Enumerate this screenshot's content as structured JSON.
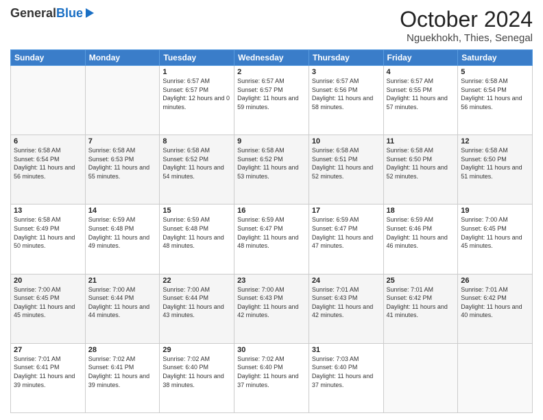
{
  "header": {
    "logo_line1": "General",
    "logo_line2": "Blue",
    "title": "October 2024",
    "subtitle": "Nguekhokh, Thies, Senegal"
  },
  "days_of_week": [
    "Sunday",
    "Monday",
    "Tuesday",
    "Wednesday",
    "Thursday",
    "Friday",
    "Saturday"
  ],
  "weeks": [
    [
      {
        "day": "",
        "sunrise": "",
        "sunset": "",
        "daylight": ""
      },
      {
        "day": "",
        "sunrise": "",
        "sunset": "",
        "daylight": ""
      },
      {
        "day": "1",
        "sunrise": "Sunrise: 6:57 AM",
        "sunset": "Sunset: 6:57 PM",
        "daylight": "Daylight: 12 hours and 0 minutes."
      },
      {
        "day": "2",
        "sunrise": "Sunrise: 6:57 AM",
        "sunset": "Sunset: 6:57 PM",
        "daylight": "Daylight: 11 hours and 59 minutes."
      },
      {
        "day": "3",
        "sunrise": "Sunrise: 6:57 AM",
        "sunset": "Sunset: 6:56 PM",
        "daylight": "Daylight: 11 hours and 58 minutes."
      },
      {
        "day": "4",
        "sunrise": "Sunrise: 6:57 AM",
        "sunset": "Sunset: 6:55 PM",
        "daylight": "Daylight: 11 hours and 57 minutes."
      },
      {
        "day": "5",
        "sunrise": "Sunrise: 6:58 AM",
        "sunset": "Sunset: 6:54 PM",
        "daylight": "Daylight: 11 hours and 56 minutes."
      }
    ],
    [
      {
        "day": "6",
        "sunrise": "Sunrise: 6:58 AM",
        "sunset": "Sunset: 6:54 PM",
        "daylight": "Daylight: 11 hours and 56 minutes."
      },
      {
        "day": "7",
        "sunrise": "Sunrise: 6:58 AM",
        "sunset": "Sunset: 6:53 PM",
        "daylight": "Daylight: 11 hours and 55 minutes."
      },
      {
        "day": "8",
        "sunrise": "Sunrise: 6:58 AM",
        "sunset": "Sunset: 6:52 PM",
        "daylight": "Daylight: 11 hours and 54 minutes."
      },
      {
        "day": "9",
        "sunrise": "Sunrise: 6:58 AM",
        "sunset": "Sunset: 6:52 PM",
        "daylight": "Daylight: 11 hours and 53 minutes."
      },
      {
        "day": "10",
        "sunrise": "Sunrise: 6:58 AM",
        "sunset": "Sunset: 6:51 PM",
        "daylight": "Daylight: 11 hours and 52 minutes."
      },
      {
        "day": "11",
        "sunrise": "Sunrise: 6:58 AM",
        "sunset": "Sunset: 6:50 PM",
        "daylight": "Daylight: 11 hours and 52 minutes."
      },
      {
        "day": "12",
        "sunrise": "Sunrise: 6:58 AM",
        "sunset": "Sunset: 6:50 PM",
        "daylight": "Daylight: 11 hours and 51 minutes."
      }
    ],
    [
      {
        "day": "13",
        "sunrise": "Sunrise: 6:58 AM",
        "sunset": "Sunset: 6:49 PM",
        "daylight": "Daylight: 11 hours and 50 minutes."
      },
      {
        "day": "14",
        "sunrise": "Sunrise: 6:59 AM",
        "sunset": "Sunset: 6:48 PM",
        "daylight": "Daylight: 11 hours and 49 minutes."
      },
      {
        "day": "15",
        "sunrise": "Sunrise: 6:59 AM",
        "sunset": "Sunset: 6:48 PM",
        "daylight": "Daylight: 11 hours and 48 minutes."
      },
      {
        "day": "16",
        "sunrise": "Sunrise: 6:59 AM",
        "sunset": "Sunset: 6:47 PM",
        "daylight": "Daylight: 11 hours and 48 minutes."
      },
      {
        "day": "17",
        "sunrise": "Sunrise: 6:59 AM",
        "sunset": "Sunset: 6:47 PM",
        "daylight": "Daylight: 11 hours and 47 minutes."
      },
      {
        "day": "18",
        "sunrise": "Sunrise: 6:59 AM",
        "sunset": "Sunset: 6:46 PM",
        "daylight": "Daylight: 11 hours and 46 minutes."
      },
      {
        "day": "19",
        "sunrise": "Sunrise: 7:00 AM",
        "sunset": "Sunset: 6:45 PM",
        "daylight": "Daylight: 11 hours and 45 minutes."
      }
    ],
    [
      {
        "day": "20",
        "sunrise": "Sunrise: 7:00 AM",
        "sunset": "Sunset: 6:45 PM",
        "daylight": "Daylight: 11 hours and 45 minutes."
      },
      {
        "day": "21",
        "sunrise": "Sunrise: 7:00 AM",
        "sunset": "Sunset: 6:44 PM",
        "daylight": "Daylight: 11 hours and 44 minutes."
      },
      {
        "day": "22",
        "sunrise": "Sunrise: 7:00 AM",
        "sunset": "Sunset: 6:44 PM",
        "daylight": "Daylight: 11 hours and 43 minutes."
      },
      {
        "day": "23",
        "sunrise": "Sunrise: 7:00 AM",
        "sunset": "Sunset: 6:43 PM",
        "daylight": "Daylight: 11 hours and 42 minutes."
      },
      {
        "day": "24",
        "sunrise": "Sunrise: 7:01 AM",
        "sunset": "Sunset: 6:43 PM",
        "daylight": "Daylight: 11 hours and 42 minutes."
      },
      {
        "day": "25",
        "sunrise": "Sunrise: 7:01 AM",
        "sunset": "Sunset: 6:42 PM",
        "daylight": "Daylight: 11 hours and 41 minutes."
      },
      {
        "day": "26",
        "sunrise": "Sunrise: 7:01 AM",
        "sunset": "Sunset: 6:42 PM",
        "daylight": "Daylight: 11 hours and 40 minutes."
      }
    ],
    [
      {
        "day": "27",
        "sunrise": "Sunrise: 7:01 AM",
        "sunset": "Sunset: 6:41 PM",
        "daylight": "Daylight: 11 hours and 39 minutes."
      },
      {
        "day": "28",
        "sunrise": "Sunrise: 7:02 AM",
        "sunset": "Sunset: 6:41 PM",
        "daylight": "Daylight: 11 hours and 39 minutes."
      },
      {
        "day": "29",
        "sunrise": "Sunrise: 7:02 AM",
        "sunset": "Sunset: 6:40 PM",
        "daylight": "Daylight: 11 hours and 38 minutes."
      },
      {
        "day": "30",
        "sunrise": "Sunrise: 7:02 AM",
        "sunset": "Sunset: 6:40 PM",
        "daylight": "Daylight: 11 hours and 37 minutes."
      },
      {
        "day": "31",
        "sunrise": "Sunrise: 7:03 AM",
        "sunset": "Sunset: 6:40 PM",
        "daylight": "Daylight: 11 hours and 37 minutes."
      },
      {
        "day": "",
        "sunrise": "",
        "sunset": "",
        "daylight": ""
      },
      {
        "day": "",
        "sunrise": "",
        "sunset": "",
        "daylight": ""
      }
    ]
  ]
}
